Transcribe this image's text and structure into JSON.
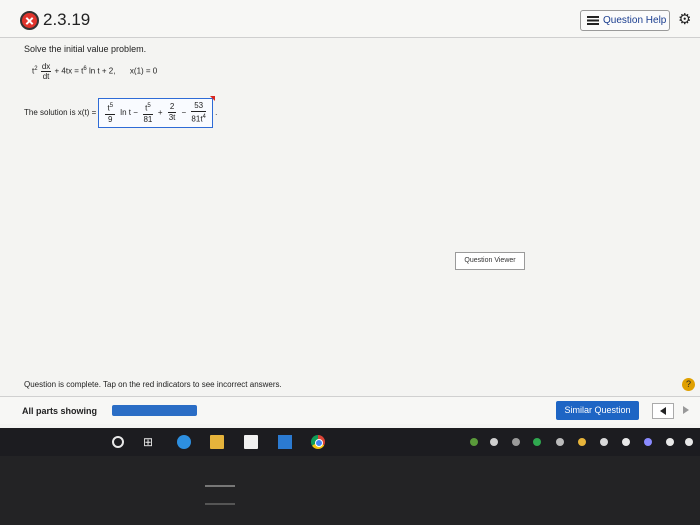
{
  "header": {
    "question_number": "2.3.19",
    "help_button_label": "Question Help",
    "status_icon": "incorrect-x-icon",
    "settings_icon": "gear-icon"
  },
  "problem": {
    "prompt": "Solve the initial value problem.",
    "equation": {
      "lhs_coef": "t",
      "lhs_coef_exp": "2",
      "deriv_num": "dx",
      "deriv_den": "dt",
      "rest": "+ 4tx = t",
      "rest_exp": "6",
      "rest_tail": " ln t + 2,",
      "initial_condition": "x(1) = 0"
    }
  },
  "solution": {
    "label": "The solution is x(t) =",
    "term1_num": "t",
    "term1_num_exp": "5",
    "term1_den": "9",
    "ln_text": "ln t −",
    "term2_num": "t",
    "term2_num_exp": "5",
    "term2_den": "81",
    "op_plus": "+",
    "term3_num": "2",
    "term3_den": "3t",
    "op_minus": "−",
    "term4_num": "53",
    "term4_den": "81t",
    "term4_den_exp": "4",
    "trailing": "."
  },
  "question_viewer": {
    "label": "Question Viewer"
  },
  "footer": {
    "status_message": "Question is complete. Tap on the red indicators to see incorrect answers.",
    "parts_label": "All parts showing",
    "parts_progress": 1.0,
    "similar_button_label": "Similar Question",
    "help_round_label": "?"
  },
  "colors": {
    "accent_blue": "#1e65c4",
    "error_red": "#e0342c",
    "help_orange": "#e0a000"
  },
  "taskbar": {
    "icons": [
      "cortana-circle-icon",
      "task-view-icon",
      "edge-icon",
      "file-explorer-icon",
      "store-icon",
      "mail-icon",
      "chrome-icon"
    ],
    "tray_icons": [
      "nvidia-icon",
      "steam-icon",
      "wifi-icon",
      "shield-icon",
      "network-icon",
      "volume-icon",
      "battery-icon"
    ]
  }
}
